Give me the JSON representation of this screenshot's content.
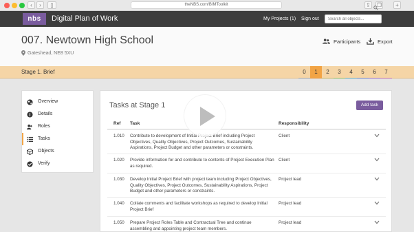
{
  "browser": {
    "url": "theNBS.com/BIMToolkit"
  },
  "header": {
    "logo": "nbs",
    "app_title": "Digital Plan of Work",
    "my_projects": "My Projects (1)",
    "sign_out": "Sign out",
    "search_placeholder": "Search all objects...",
    "background": "#3d3d3d",
    "brand_color": "#7a5c9e"
  },
  "project": {
    "title": "007. Newtown High School",
    "location": "Gateshead, NE8 5XU",
    "actions": {
      "participants": "Participants",
      "export": "Export"
    }
  },
  "stage_bar": {
    "label": "Stage 1. Brief",
    "tabs": [
      "0",
      "1",
      "2",
      "3",
      "4",
      "5",
      "6",
      "7"
    ],
    "active_tab": "1",
    "color": "#f5d5a6",
    "active_color": "#f2a445"
  },
  "sidebar": {
    "items": [
      {
        "label": "Overview",
        "icon": "globe-icon"
      },
      {
        "label": "Details",
        "icon": "info-icon"
      },
      {
        "label": "Roles",
        "icon": "users-icon"
      },
      {
        "label": "Tasks",
        "icon": "list-icon"
      },
      {
        "label": "Objects",
        "icon": "cube-icon"
      },
      {
        "label": "Verify",
        "icon": "check-globe-icon"
      }
    ],
    "active_item": "Tasks"
  },
  "tasks": {
    "title": "Tasks at Stage 1",
    "add_button": "Add task",
    "columns": {
      "ref": "Ref",
      "task": "Task",
      "responsibility": "Responsibility"
    },
    "rows": [
      {
        "ref": "1.010",
        "task": "Contribute to development of Initial Project Brief including Project Objectives, Quality Objectives, Project Outcomes, Sustainability Aspirations, Project Budget and other parameters or constraints.",
        "responsibility": "Client"
      },
      {
        "ref": "1.020",
        "task": "Provide information for and contribute to contents of Project Execution Plan as required.",
        "responsibility": "Client"
      },
      {
        "ref": "1.030",
        "task": "Develop Initial Project Brief with project team including Project Objectives, Quality Objectives, Project Outcomes, Sustainability Aspirations, Project Budget and other parameters or constraints.",
        "responsibility": "Project lead"
      },
      {
        "ref": "1.040",
        "task": "Collate comments and facilitate workshops as required to develop Initial Project Brief",
        "responsibility": "Project lead"
      },
      {
        "ref": "1.050",
        "task": "Prepare Project Roles Table and Contractual Tree and continue assembling and appointing project team members.",
        "responsibility": "Project lead"
      }
    ]
  }
}
